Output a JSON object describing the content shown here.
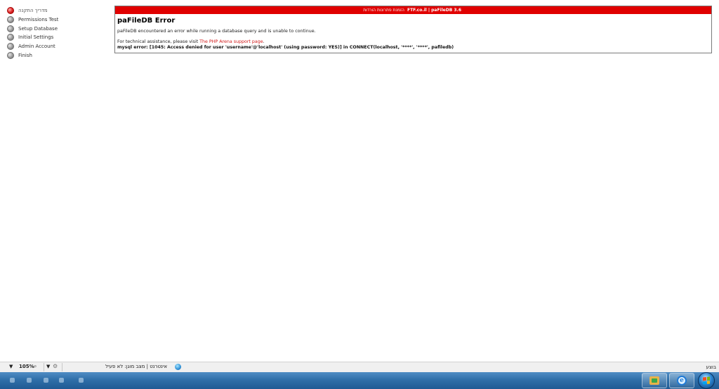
{
  "steps": [
    {
      "label": "מדריך התקנה",
      "active": true
    },
    {
      "label": "Permissions Test",
      "active": false
    },
    {
      "label": "Setup Database",
      "active": false
    },
    {
      "label": "Initial Settings",
      "active": false
    },
    {
      "label": "Admin Account",
      "active": false
    },
    {
      "label": "Finish",
      "active": false
    }
  ],
  "panel": {
    "header_brand": "FTF.co.il | paFileDB 3.6",
    "header_sub": "הזמנת פתרונות הורדות",
    "error_title": "paFileDB Error",
    "error_message": "paFileDB encountered an error while running a database query and is unable to continue.",
    "assistance_prefix": "For technical assistance, please visit ",
    "support_link_text": "The PHP Arena support page",
    "assistance_suffix": ".",
    "mysql_error": "mysql error: [1045: Access denied for user 'username'@'localhost' (using password: YES)] in CONNECT(localhost, '****', '****', pafiledb)"
  },
  "statusbar": {
    "done_text": "בוצע",
    "zone_text": "אינטרנט | מצב מוגן: לא פעיל",
    "zoom_value": "105%",
    "zoom_arrow": "▼",
    "protected_arrow": "▼"
  },
  "colors": {
    "header_red": "#e00000",
    "link_red": "#d21a1a",
    "taskbar_blue": "#2f6fa9"
  },
  "icons": {
    "zone": "globe-icon",
    "zoom": "magnifier-icon",
    "protected": "protected-mode-icon",
    "start": "windows-start-icon",
    "browser": "internet-explorer-icon"
  }
}
